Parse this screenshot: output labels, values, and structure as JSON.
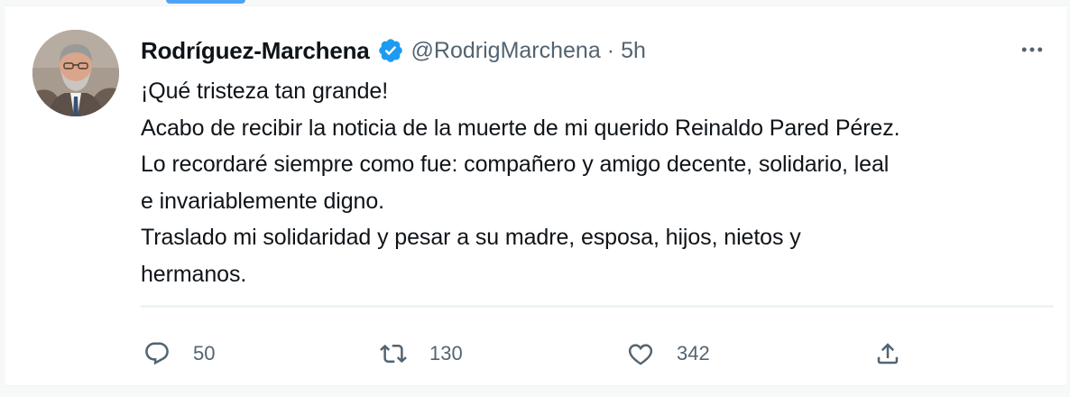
{
  "tweet": {
    "author": {
      "display_name": "Rodríguez-Marchena",
      "handle": "@RodrigMarchena",
      "verified": true,
      "avatar_icon": "profile-photo"
    },
    "separator": "·",
    "timestamp": "5h",
    "text_lines": [
      "¡Qué tristeza tan grande!",
      "Acabo de recibir la noticia de la muerte de mi querido Reinaldo Pared Pérez.",
      "Lo recordaré siempre como fue: compañero y amigo decente, solidario, leal",
      "e invariablemente digno.",
      "Traslado mi solidaridad y pesar a su madre, esposa, hijos, nietos y",
      "hermanos."
    ],
    "actions": {
      "reply_count": "50",
      "retweet_count": "130",
      "like_count": "342"
    }
  },
  "colors": {
    "text_primary": "#0f1419",
    "text_secondary": "#536471",
    "verified_blue": "#1d9bf0",
    "divider": "#eff3f4"
  },
  "icons": {
    "verified": "verified-badge-icon",
    "more": "more-options-icon",
    "reply": "reply-icon",
    "retweet": "retweet-icon",
    "like": "heart-icon",
    "share": "share-icon"
  }
}
